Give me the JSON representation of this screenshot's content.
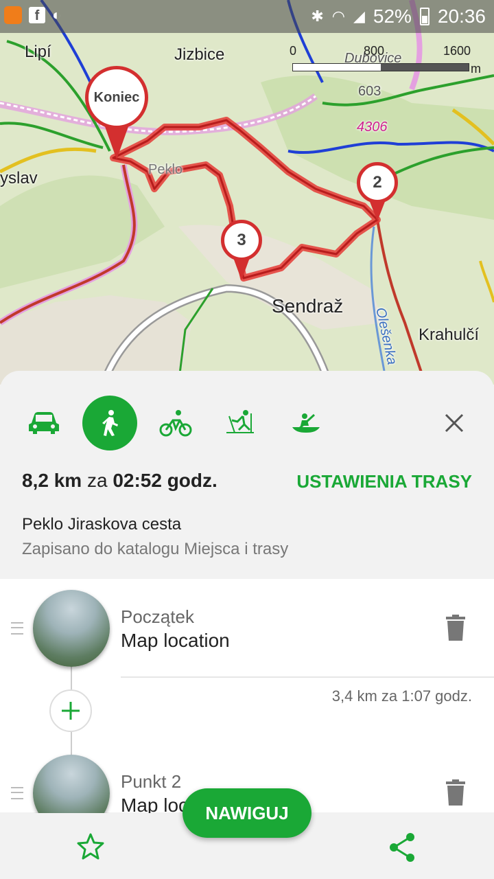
{
  "status_bar": {
    "battery": "52%",
    "time": "20:36",
    "app_icons": [
      "app-icon",
      "facebook-icon",
      "mute-icon"
    ],
    "sys_icons": [
      "bluetooth-icon",
      "wifi-icon",
      "signal-icon"
    ]
  },
  "map": {
    "labels": [
      "Lipí",
      "Jizbice",
      "Dubovice",
      "603",
      "4306",
      "yslav",
      "Peklo",
      "Sendraž",
      "Olešenka",
      "Krahulčí"
    ],
    "scale": {
      "ticks": [
        "0",
        "800",
        "1600"
      ],
      "unit": "m"
    },
    "pins": {
      "end": "Koniec",
      "p2": "2",
      "p3": "3"
    }
  },
  "route": {
    "modes": [
      "car",
      "walk",
      "bike",
      "ski",
      "canoe"
    ],
    "active_mode": "walk",
    "distance": "8,2 km",
    "za": "za",
    "duration": "02:52 godz.",
    "settings_label": "USTAWIENIA TRASY",
    "name": "Peklo Jiraskova cesta",
    "saved_note": "Zapisano do katalogu Miejsca i trasy"
  },
  "waypoints": [
    {
      "label": "Początek",
      "name": "Map location"
    },
    {
      "label": "Punkt 2",
      "name": "Map location"
    }
  ],
  "segment": {
    "distance": "3,4 km za 1:07 godz."
  },
  "bottom": {
    "navigate_label": "NAWIGUJ"
  },
  "colors": {
    "accent": "#1aa836",
    "route": "#d32f2f"
  }
}
